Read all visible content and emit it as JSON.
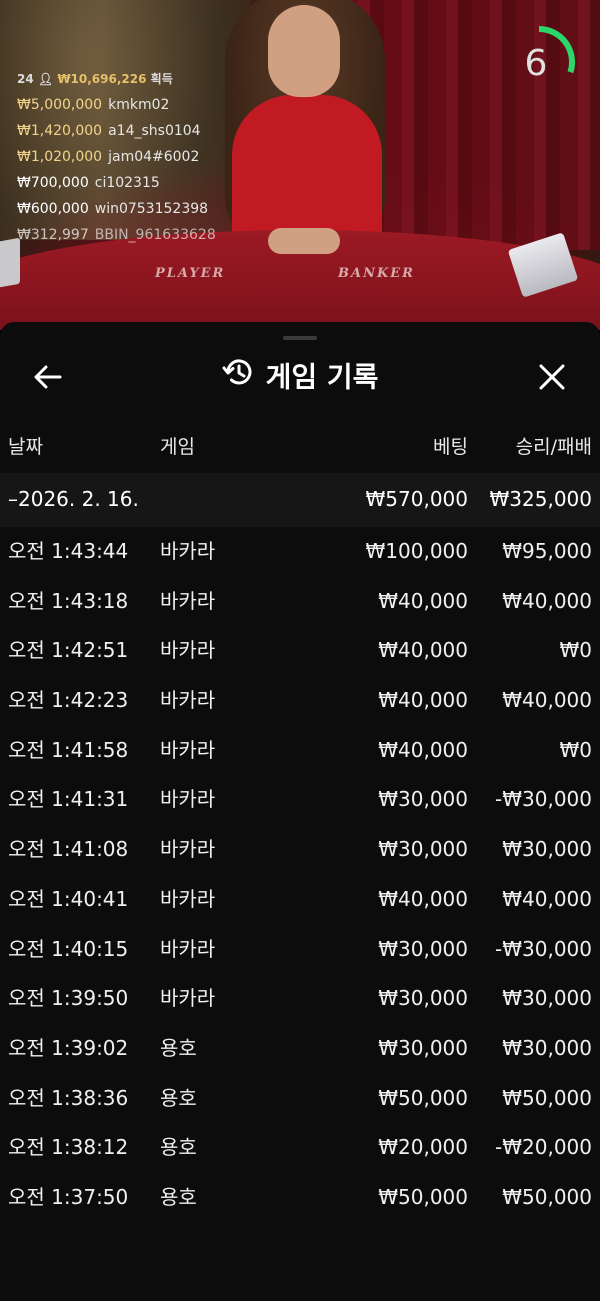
{
  "stream": {
    "winners_header": {
      "count": "24",
      "amount": "₩10,696,226",
      "label": "획득"
    },
    "winners": [
      {
        "amount": "₩5,000,000",
        "name": "kmkm02"
      },
      {
        "amount": "₩1,420,000",
        "name": "a14_shs0104"
      },
      {
        "amount": "₩1,020,000",
        "name": "jam04#6002"
      },
      {
        "amount": "₩700,000",
        "name": "ci102315"
      },
      {
        "amount": "₩600,000",
        "name": "win0753152398"
      },
      {
        "amount": "₩312,997",
        "name": "BBIN_961633628"
      }
    ],
    "table_labels": {
      "player": "PLAYER",
      "banker": "BANKER"
    },
    "countdown": "6",
    "countdown_fraction": 0.6,
    "accent_color": "#2bd66a"
  },
  "panel": {
    "title": "게임 기록",
    "icons": {
      "back": "arrow-left-icon",
      "title": "history-icon",
      "close": "close-icon"
    },
    "columns": {
      "date": "날짜",
      "game": "게임",
      "bet": "베팅",
      "winloss": "승리/패배"
    },
    "date_group": {
      "date": "–2026. 2. 16.",
      "bet_total": "₩570,000",
      "winloss_total": "₩325,000"
    },
    "rows": [
      {
        "time": "오전 1:43:44",
        "game": "바카라",
        "bet": "₩100,000",
        "winloss": "₩95,000"
      },
      {
        "time": "오전 1:43:18",
        "game": "바카라",
        "bet": "₩40,000",
        "winloss": "₩40,000"
      },
      {
        "time": "오전 1:42:51",
        "game": "바카라",
        "bet": "₩40,000",
        "winloss": "₩0"
      },
      {
        "time": "오전 1:42:23",
        "game": "바카라",
        "bet": "₩40,000",
        "winloss": "₩40,000"
      },
      {
        "time": "오전 1:41:58",
        "game": "바카라",
        "bet": "₩40,000",
        "winloss": "₩0"
      },
      {
        "time": "오전 1:41:31",
        "game": "바카라",
        "bet": "₩30,000",
        "winloss": "-₩30,000"
      },
      {
        "time": "오전 1:41:08",
        "game": "바카라",
        "bet": "₩30,000",
        "winloss": "₩30,000"
      },
      {
        "time": "오전 1:40:41",
        "game": "바카라",
        "bet": "₩40,000",
        "winloss": "₩40,000"
      },
      {
        "time": "오전 1:40:15",
        "game": "바카라",
        "bet": "₩30,000",
        "winloss": "-₩30,000"
      },
      {
        "time": "오전 1:39:50",
        "game": "바카라",
        "bet": "₩30,000",
        "winloss": "₩30,000"
      },
      {
        "time": "오전 1:39:02",
        "game": "용호",
        "bet": "₩30,000",
        "winloss": "₩30,000"
      },
      {
        "time": "오전 1:38:36",
        "game": "용호",
        "bet": "₩50,000",
        "winloss": "₩50,000"
      },
      {
        "time": "오전 1:38:12",
        "game": "용호",
        "bet": "₩20,000",
        "winloss": "-₩20,000"
      },
      {
        "time": "오전 1:37:50",
        "game": "용호",
        "bet": "₩50,000",
        "winloss": "₩50,000"
      }
    ]
  }
}
